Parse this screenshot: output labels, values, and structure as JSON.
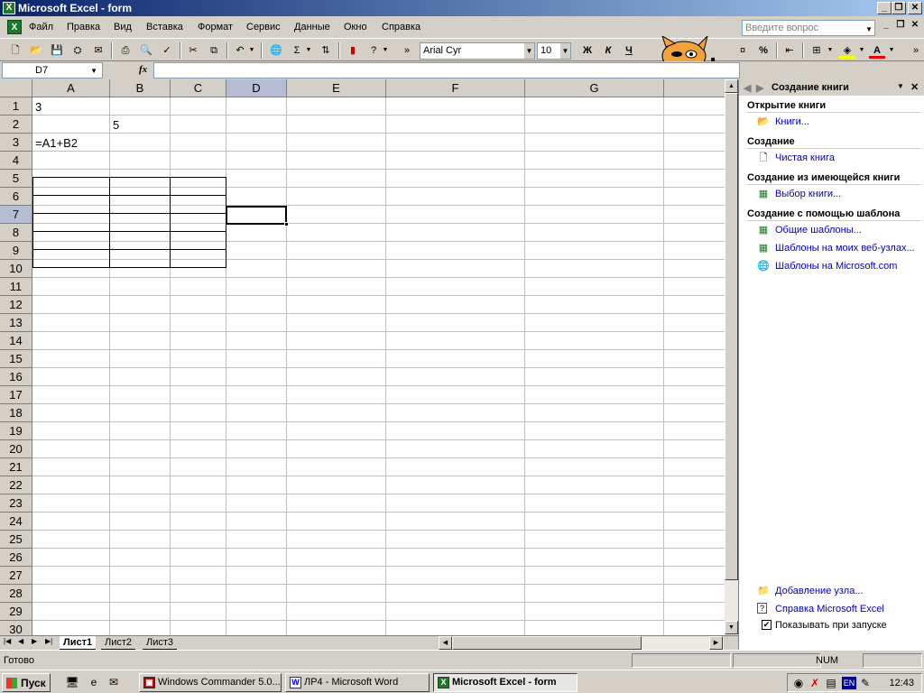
{
  "window": {
    "title": "Microsoft Excel - form"
  },
  "menu": [
    "Файл",
    "Правка",
    "Вид",
    "Вставка",
    "Формат",
    "Сервис",
    "Данные",
    "Окно",
    "Справка"
  ],
  "help_box": {
    "placeholder": "Введите вопрос"
  },
  "toolbar": {
    "font_name": "Arial Cyr",
    "font_size": "10",
    "bold": "Ж",
    "italic": "К",
    "underline": "Ч",
    "percent": "%",
    "sigma": "Σ",
    "fx": "fx"
  },
  "namebox": {
    "value": "D7"
  },
  "columns": [
    "A",
    "B",
    "C",
    "D",
    "E",
    "F",
    "G"
  ],
  "rows": [
    "1",
    "2",
    "3",
    "4",
    "5",
    "6",
    "7",
    "8",
    "9",
    "10",
    "11",
    "12",
    "13",
    "14",
    "15",
    "16",
    "17",
    "18",
    "19",
    "20",
    "21",
    "22",
    "23",
    "24",
    "25",
    "26",
    "27",
    "28",
    "29",
    "30"
  ],
  "cells": {
    "A1": "3",
    "B2": "5",
    "A3": "=A1+B2"
  },
  "sheet_tabs": [
    "Лист1",
    "Лист2",
    "Лист3"
  ],
  "taskpane": {
    "title": "Создание книги",
    "sections": [
      {
        "heading": "Открытие книги",
        "links": [
          "Книги..."
        ]
      },
      {
        "heading": "Создание",
        "links": [
          "Чистая книга"
        ]
      },
      {
        "heading": "Создание из имеющейся книги",
        "links": [
          "Выбор книги..."
        ]
      },
      {
        "heading": "Создание с помощью шаблона",
        "links": [
          "Общие шаблоны...",
          "Шаблоны на моих веб-узлах...",
          "Шаблоны на Microsoft.com"
        ]
      }
    ],
    "bottom": {
      "add_node": "Добавление узла...",
      "help": "Справка Microsoft Excel",
      "show_on_startup": "Показывать при запуске"
    }
  },
  "status": {
    "ready": "Готово",
    "num": "NUM"
  },
  "taskbar": {
    "start": "Пуск",
    "tasks": [
      "Windows Commander 5.0...",
      "ЛР4 - Microsoft Word",
      "Microsoft Excel - form"
    ],
    "lang": "EN",
    "clock": "12:43"
  },
  "colors": {
    "title_start": "#0a246a",
    "title_end": "#a6caf0",
    "selected_header": "#b6bdd2",
    "link": "#0000c0"
  }
}
